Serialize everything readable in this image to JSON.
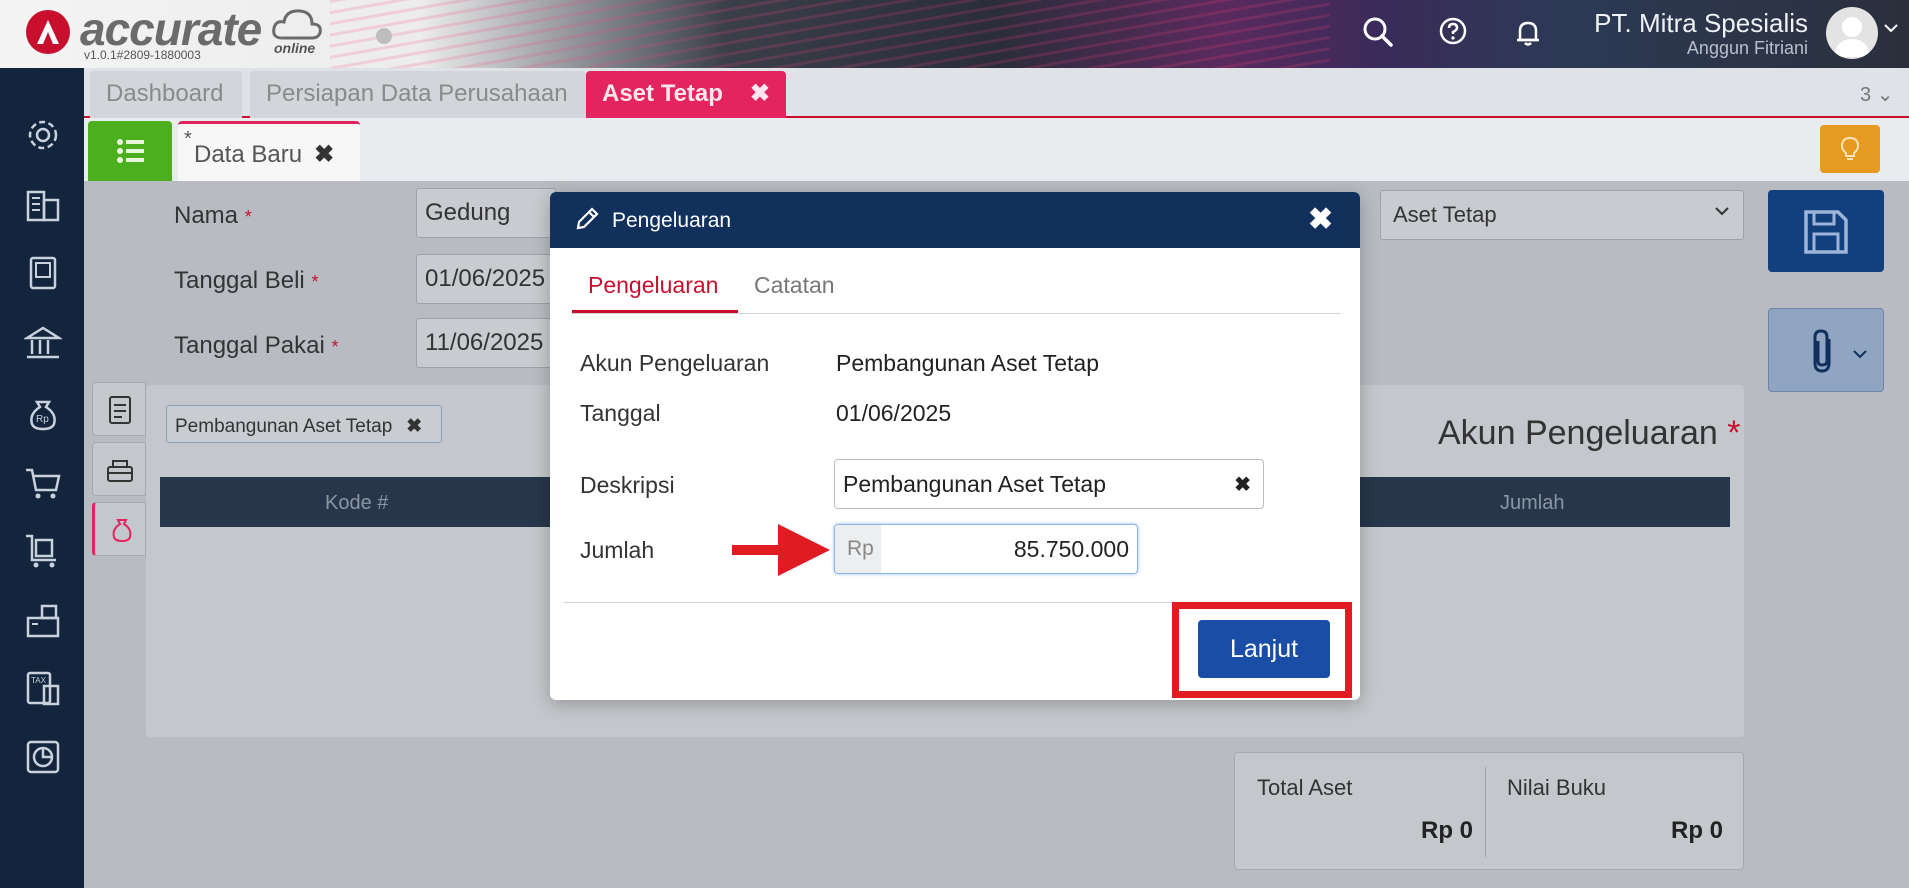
{
  "header": {
    "logo_text": "accurate",
    "logo_sub": "online",
    "version": "v1.0.1#2809-1880003",
    "company": "PT. Mitra Spesialis",
    "user": "Anggun Fitriani"
  },
  "tabs": [
    {
      "label": "Dashboard"
    },
    {
      "label": "Persiapan Data Perusahaan"
    },
    {
      "label": "Aset Tetap",
      "active": true
    }
  ],
  "tab_count": "3",
  "subtab": {
    "asterisk": "*",
    "label": "Data Baru"
  },
  "form": {
    "nama_label": "Nama",
    "nama_value": "Gedung",
    "tanggal_beli_label": "Tanggal Beli",
    "tanggal_beli_value": "01/06/2025",
    "tanggal_pakai_label": "Tanggal Pakai",
    "tanggal_pakai_value": "11/06/2025",
    "required_mark": "*",
    "kategori_value": "Aset Tetap"
  },
  "panel": {
    "tag": "Pembangunan Aset Tetap",
    "title": "Akun Pengeluaran",
    "columns": [
      "Kode #",
      "Jumlah"
    ]
  },
  "totals": {
    "total_aset_label": "Total Aset",
    "total_aset_value": "Rp 0",
    "nilai_buku_label": "Nilai Buku",
    "nilai_buku_value": "Rp 0"
  },
  "modal": {
    "title": "Pengeluaran",
    "tabs": [
      "Pengeluaran",
      "Catatan"
    ],
    "akun_label": "Akun Pengeluaran",
    "akun_value": "Pembangunan Aset Tetap",
    "tanggal_label": "Tanggal",
    "tanggal_value": "01/06/2025",
    "deskripsi_label": "Deskripsi",
    "deskripsi_value": "Pembangunan Aset Tetap",
    "jumlah_label": "Jumlah",
    "currency_prefix": "Rp",
    "jumlah_value": "85.750.000",
    "submit_label": "Lanjut"
  },
  "icons": {
    "close": "✖",
    "chevron": "⌄"
  },
  "colors": {
    "accent_red": "#c8102e",
    "active_tab": "#e4245e",
    "modal_header": "#12305c",
    "primary_button": "#1a4ea6",
    "sidebar": "#13243d",
    "highlight_box": "#e01b22"
  }
}
